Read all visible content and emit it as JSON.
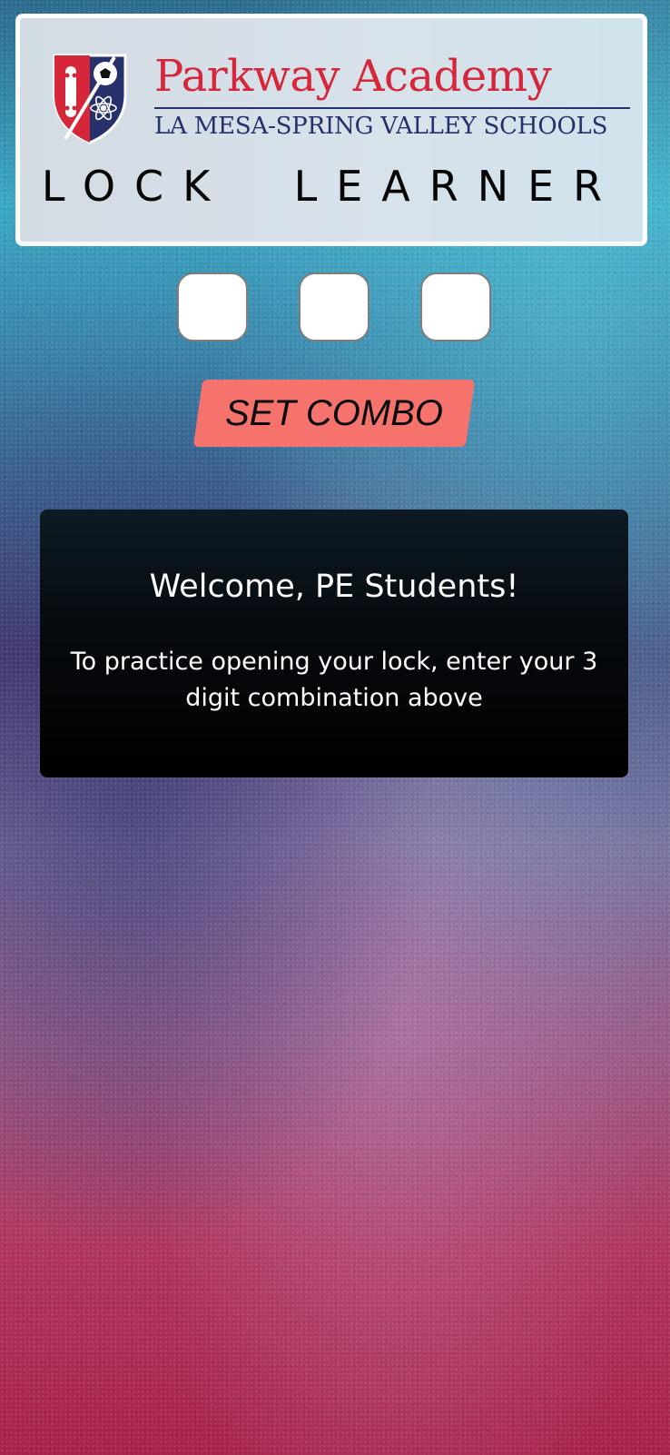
{
  "header": {
    "school_name": "Parkway Academy",
    "school_district": "LA MESA-SPRING VALLEY SCHOOLS",
    "app_title": "LOCK  LEARNER",
    "brand_red": "#d6263a",
    "brand_navy": "#26306a",
    "crest_icons": [
      "skateboard-icon",
      "soccer-ball-icon",
      "atom-icon"
    ]
  },
  "combo": {
    "digits": [
      {
        "value": "",
        "placeholder": ""
      },
      {
        "value": "",
        "placeholder": ""
      },
      {
        "value": "",
        "placeholder": ""
      }
    ],
    "set_button_label": "SET COMBO",
    "button_color": "#f6736d"
  },
  "welcome": {
    "title": "Welcome, PE Students!",
    "message": "To practice opening your lock, enter your 3 digit combination above"
  }
}
